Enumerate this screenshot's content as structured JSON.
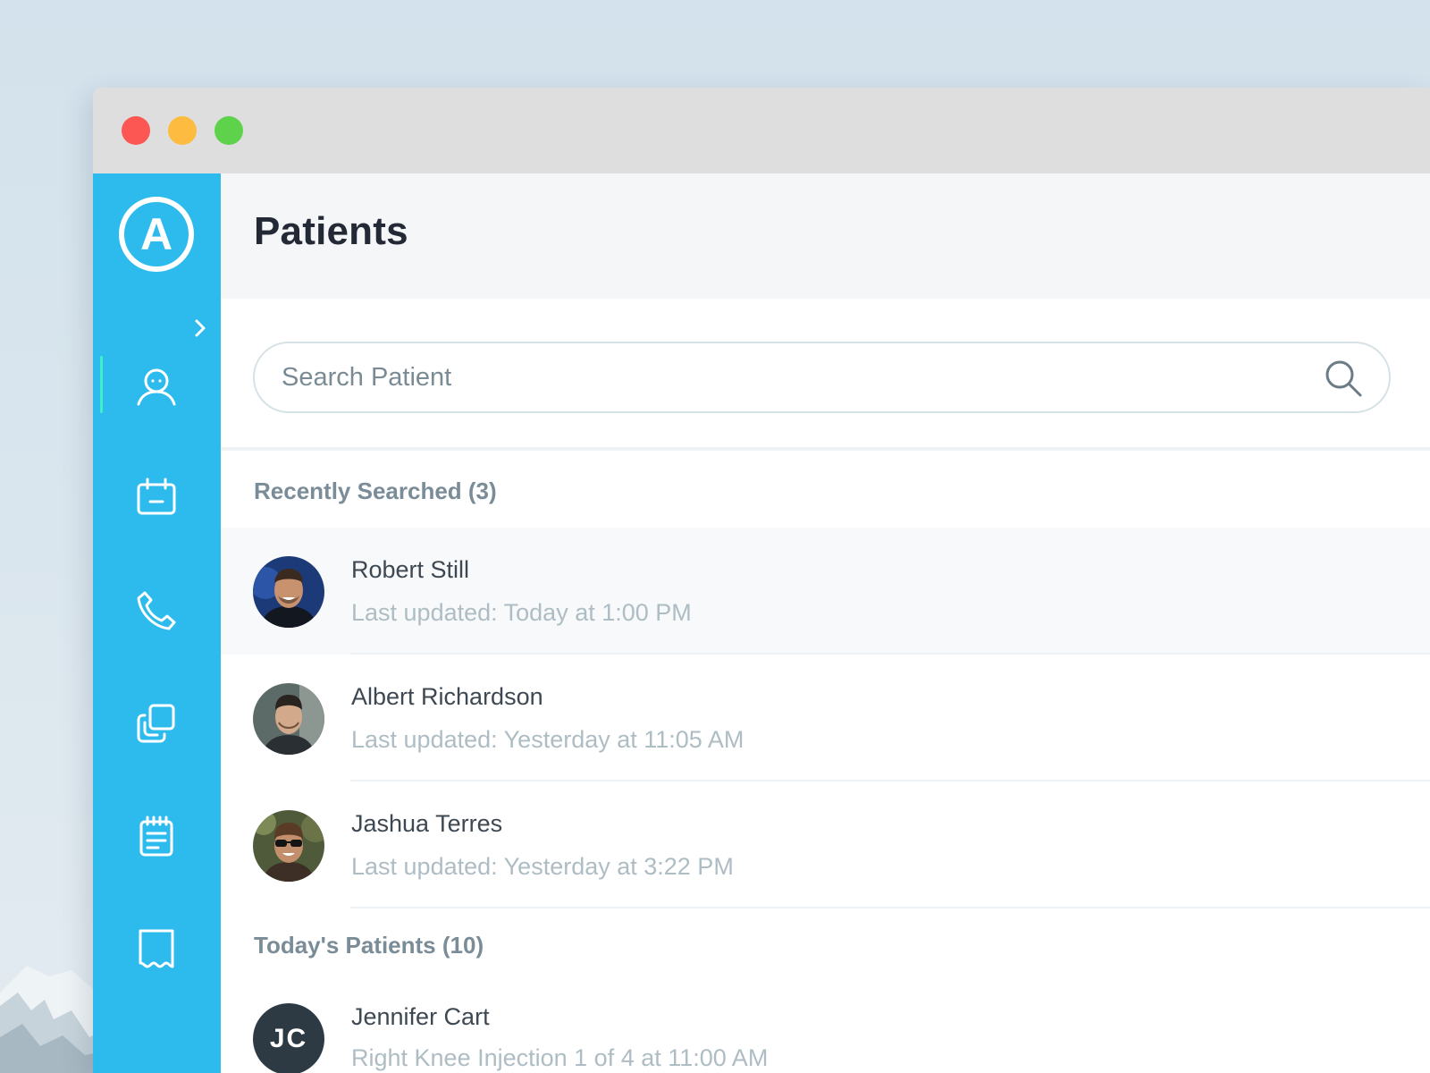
{
  "page": {
    "title": "Patients"
  },
  "search": {
    "placeholder": "Search Patient"
  },
  "sidebar": {
    "logo_letter": "A",
    "items": [
      {
        "icon": "patient-icon",
        "active": true
      },
      {
        "icon": "calendar-icon",
        "active": false
      },
      {
        "icon": "phone-icon",
        "active": false
      },
      {
        "icon": "copy-icon",
        "active": false
      },
      {
        "icon": "notepad-icon",
        "active": false
      },
      {
        "icon": "receipt-icon",
        "active": false
      }
    ]
  },
  "recently_searched": {
    "title": "Recently Searched (3)",
    "patients": [
      {
        "name": "Robert Still",
        "subtitle": "Last updated: Today at 1:00 PM"
      },
      {
        "name": "Albert Richardson",
        "subtitle": "Last updated: Yesterday at 11:05 AM"
      },
      {
        "name": "Jashua Terres",
        "subtitle": "Last updated: Yesterday at 3:22 PM"
      }
    ]
  },
  "todays_patients": {
    "title": "Today's Patients (10)",
    "patients": [
      {
        "name": "Jennifer Cart",
        "initials": "JC",
        "subtitle": "Right Knee Injection 1 of 4 at 11:00 AM"
      }
    ]
  },
  "colors": {
    "sidebar": "#2dbbed",
    "active_indicator": "#3ef0c6",
    "traffic_red": "#fc5753",
    "traffic_yellow": "#fdbc40",
    "traffic_green": "#5ed24a"
  }
}
